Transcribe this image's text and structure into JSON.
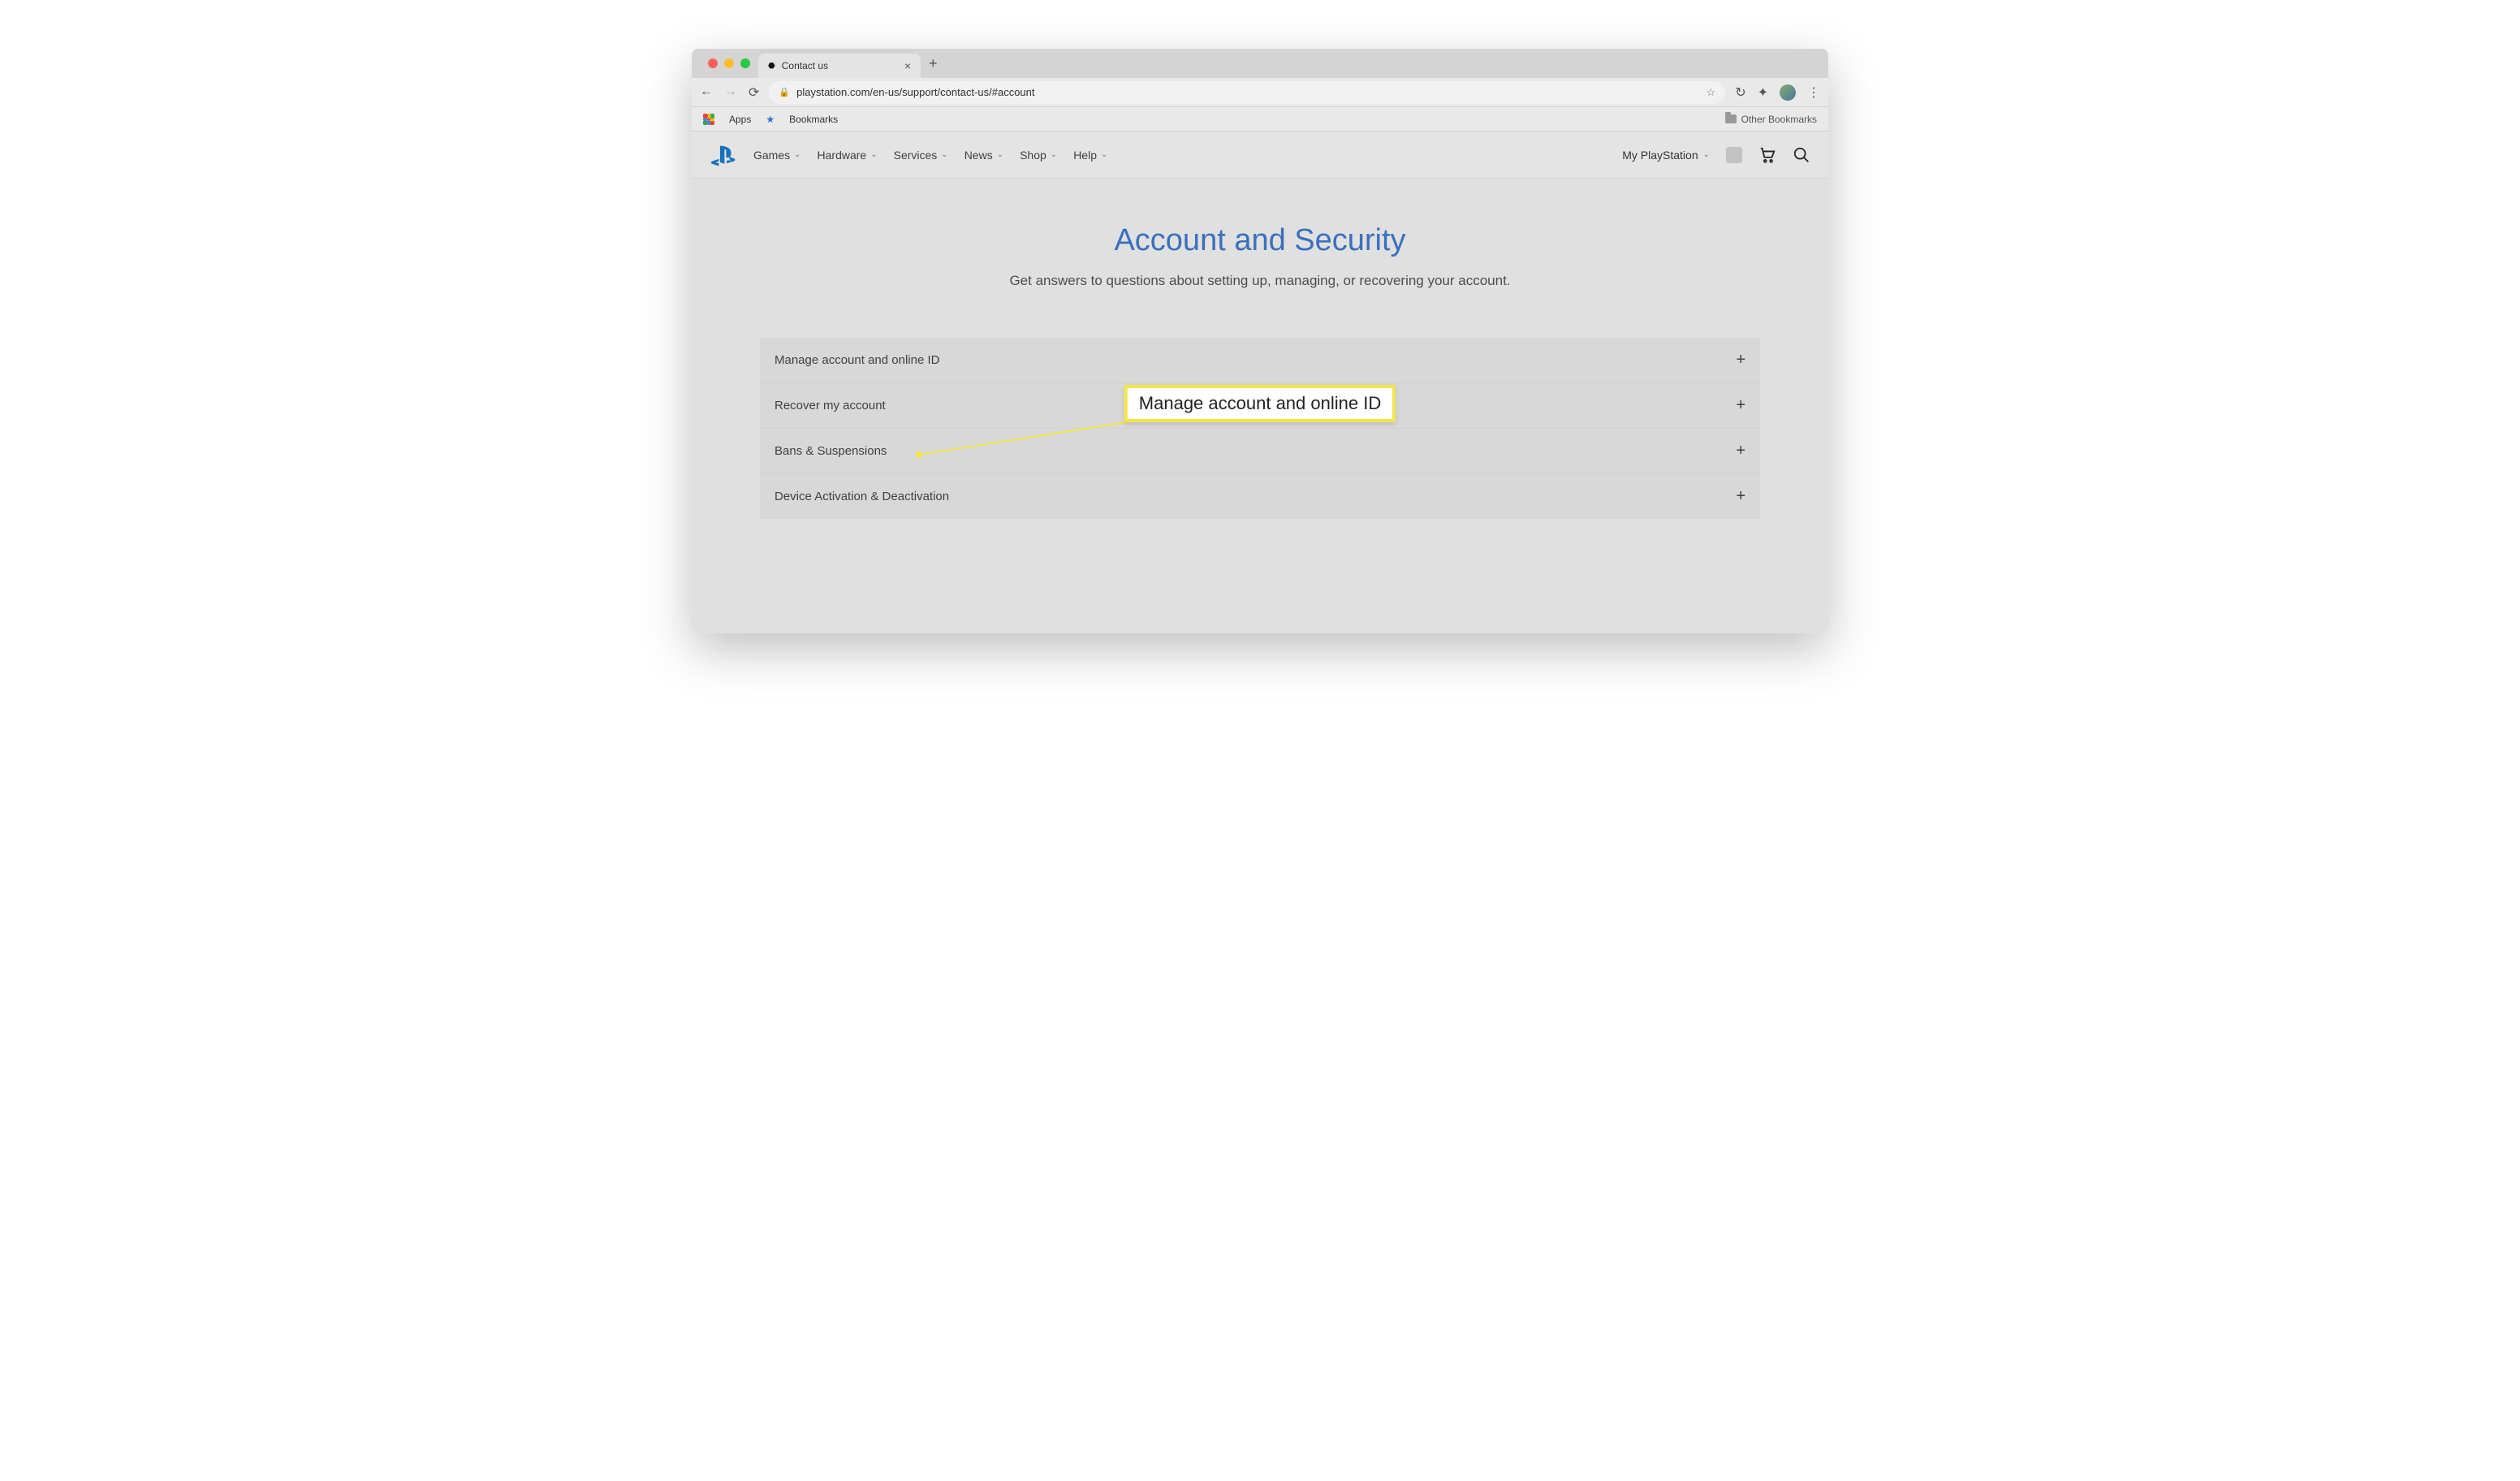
{
  "browser": {
    "tab_title": "Contact us",
    "url": "playstation.com/en-us/support/contact-us/#account",
    "bookmarks": {
      "apps": "Apps",
      "bookmarks": "Bookmarks",
      "other": "Other Bookmarks"
    }
  },
  "sitenav": {
    "items": [
      "Games",
      "Hardware",
      "Services",
      "News",
      "Shop",
      "Help"
    ],
    "my_ps": "My PlayStation"
  },
  "page": {
    "title": "Account and Security",
    "subtitle": "Get answers to questions about setting up, managing, or recovering your account.",
    "accordion": [
      "Manage account and online ID",
      "Recover my account",
      "Bans & Suspensions",
      "Device Activation & Deactivation"
    ]
  },
  "annotation": {
    "callout": "Manage account and online ID"
  }
}
